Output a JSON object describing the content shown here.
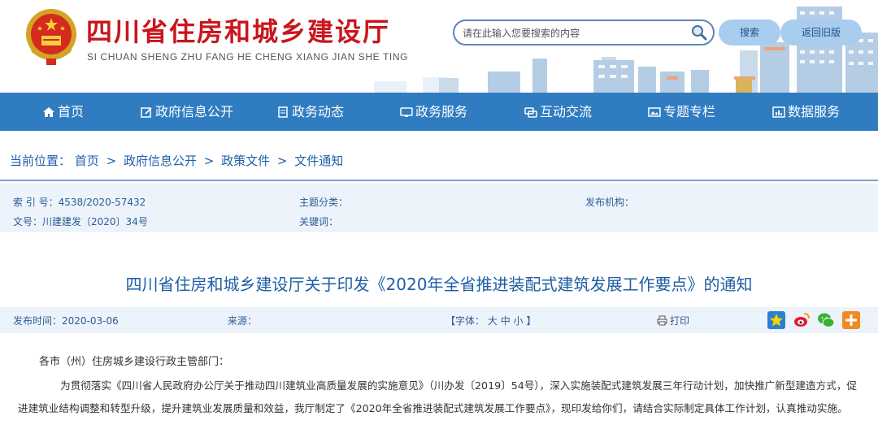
{
  "header": {
    "title": "四川省住房和城乡建设厅",
    "subtitle": "SI CHUAN SHENG ZHU FANG HE CHENG XIANG JIAN SHE TING",
    "search_placeholder": "请在此输入您要搜索的内容",
    "search_button": "搜索",
    "old_version_button": "返回旧版"
  },
  "nav": {
    "items": [
      {
        "label": "首页",
        "icon": "home-icon"
      },
      {
        "label": "政府信息公开",
        "icon": "edit-icon"
      },
      {
        "label": "政务动态",
        "icon": "document-icon"
      },
      {
        "label": "政务服务",
        "icon": "monitor-icon"
      },
      {
        "label": "互动交流",
        "icon": "chat-icon"
      },
      {
        "label": "专题专栏",
        "icon": "image-icon"
      },
      {
        "label": "数据服务",
        "icon": "data-icon"
      }
    ]
  },
  "breadcrumb": {
    "prefix": "当前位置：",
    "items": [
      "首页",
      "政府信息公开",
      "政策文件",
      "文件通知"
    ],
    "separator": ">"
  },
  "meta": {
    "index_label": "索 引 号：",
    "index_value": "4538/2020-57432",
    "category_label": "主题分类：",
    "publisher_label": "发布机构：",
    "doc_no_label": "文号：",
    "doc_no_value": "川建建发〔2020〕34号",
    "keywords_label": "关键词："
  },
  "article": {
    "title": "四川省住房和城乡建设厅关于印发《2020年全省推进装配式建筑发展工作要点》的通知",
    "publish_label": "发布时间：",
    "publish_date": "2020-03-06",
    "source_label": "来源：",
    "font_label_open": "【字体：",
    "font_large": "大",
    "font_medium": "中",
    "font_small": "小",
    "font_label_close": "】",
    "print_label": "打印",
    "share_icons": [
      "favorite-icon",
      "weibo-icon",
      "wechat-icon",
      "more-share-icon"
    ]
  },
  "body": {
    "salutation": "各市（州）住房城乡建设行政主管部门：",
    "paragraph_line1": "为贯彻落实《四川省人民政府办公厅关于推动四川建筑业高质量发展的实施意见》（川办发〔2019〕54号），深入实施装配式建筑发展三年行动计划，加快推广新型建造方式，促",
    "paragraph_line2": "进建筑业结构调整和转型升级，提升建筑业发展质量和效益，我厅制定了《2020年全省推进装配式建筑发展工作要点》，现印发给你们，请结合实际制定具体工作计划，认真推动实施。"
  },
  "colors": {
    "title_red": "#c8161d",
    "nav_blue": "#2f7cc1",
    "link_blue": "#1f5fa8",
    "meta_bg": "#edf3fa"
  }
}
